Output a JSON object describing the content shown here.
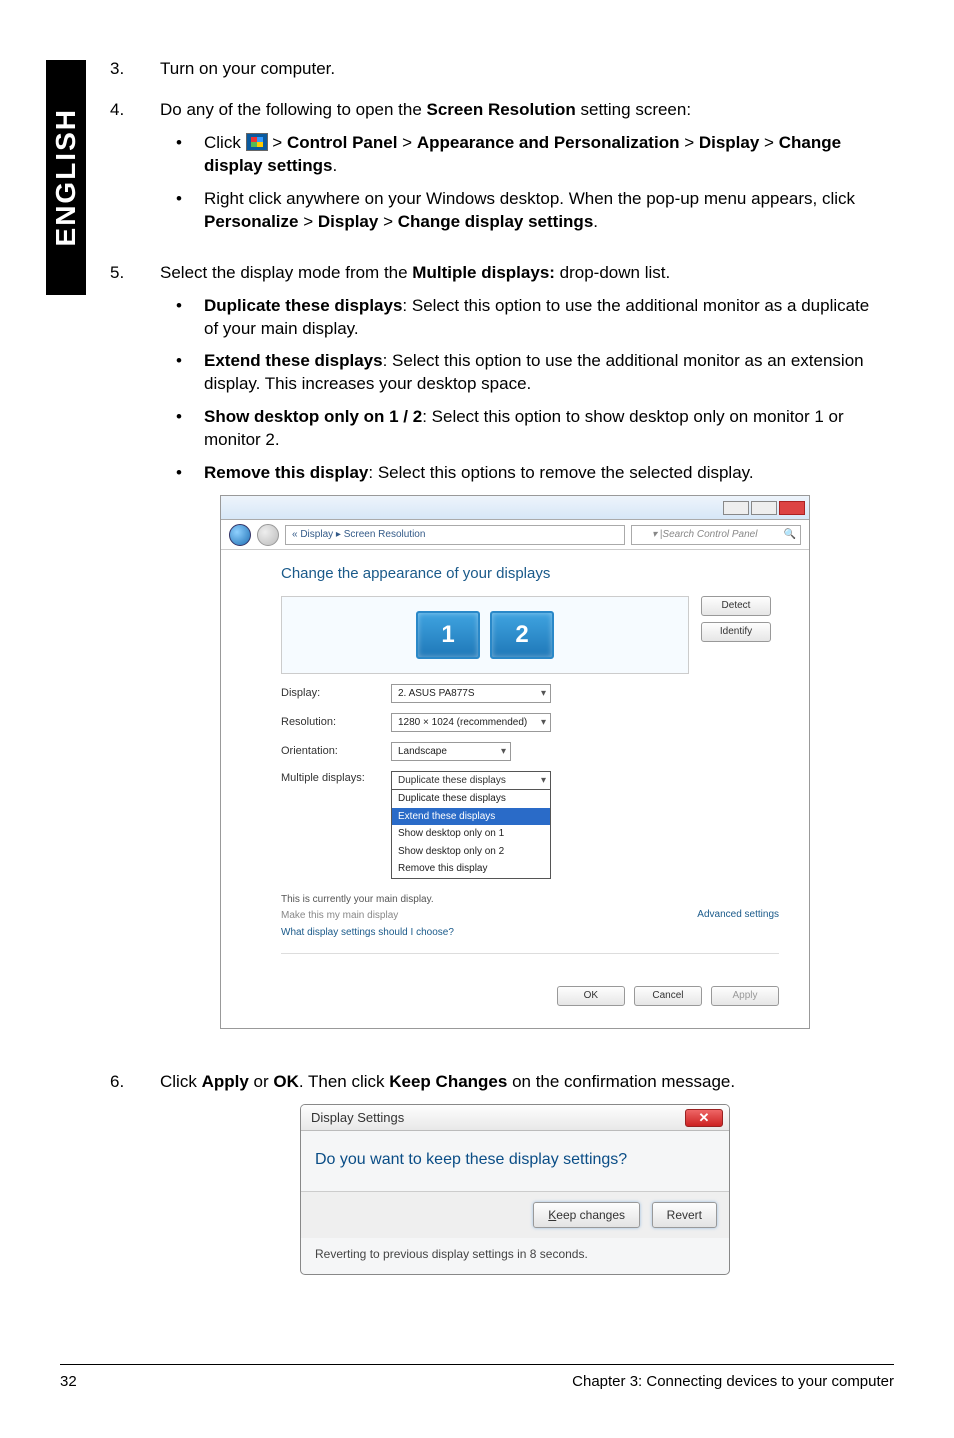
{
  "sidebar": {
    "label": "ENGLISH"
  },
  "steps": {
    "s3": {
      "num": "3.",
      "text": "Turn on your computer."
    },
    "s4": {
      "num": "4.",
      "intro_a": "Do any of the following to open the ",
      "intro_bold": "Screen Resolution",
      "intro_b": " setting screen:",
      "b1_a": "Click ",
      "b1_b": " > ",
      "b1_cp": "Control Panel",
      "b1_gt1": " > ",
      "b1_ap": "Appearance and Personalization",
      "b1_gt2": " > ",
      "b1_disp": "Display",
      "b1_gt3": " > ",
      "b1_cds": "Change display settings",
      "b1_dot": ".",
      "b2_a": "Right click anywhere on your Windows desktop. When the pop-up menu appears, click ",
      "b2_p": "Personalize",
      "b2_g1": " > ",
      "b2_d": "Display",
      "b2_g2": " > ",
      "b2_c": "Change display settings",
      "b2_dot": "."
    },
    "s5": {
      "num": "5.",
      "intro_a": "Select the display mode from the ",
      "intro_bold": "Multiple displays:",
      "intro_b": " drop-down list.",
      "i1_t": "Duplicate these displays",
      "i1_r": ": Select this option to use the additional monitor as a duplicate of your main display.",
      "i2_t": "Extend these displays",
      "i2_r": ": Select this option to use the additional monitor as an extension display. This increases your desktop space.",
      "i3_t": "Show desktop only on 1 / 2",
      "i3_r": ": Select this option to show desktop only on monitor 1 or monitor 2.",
      "i4_t": "Remove this display",
      "i4_r": ": Select this options to remove the selected display."
    },
    "s6": {
      "num": "6.",
      "a": "Click ",
      "apply": "Apply",
      "or": " or ",
      "ok": "OK",
      "b": ". Then click ",
      "kc": "Keep Changes",
      "c": " on the confirmation message."
    }
  },
  "shot1": {
    "crumb": "« Display ▸ Screen Resolution",
    "search_icon": "▾ | ",
    "search_ph": "Search Control Panel",
    "heading": "Change the appearance of your displays",
    "mon1": "1",
    "mon2": "2",
    "detect": "Detect",
    "identify": "Identify",
    "lbl_display": "Display:",
    "val_display": "2. ASUS PA877S",
    "lbl_res": "Resolution:",
    "val_res": "1280 × 1024 (recommended)",
    "lbl_orient": "Orientation:",
    "val_orient": "Landscape",
    "lbl_multi": "Multiple displays:",
    "opt0": "Duplicate these displays",
    "opt1": "Duplicate these displays",
    "opt2": "Extend these displays",
    "opt3": "Show desktop only on 1",
    "opt4": "Show desktop only on 2",
    "opt5": "Remove this display",
    "currently": "This is currently your main display.",
    "make_main": "Make this my main display",
    "adv": "Advanced settings",
    "whatlink": "What display settings should I choose?",
    "btn_ok": "OK",
    "btn_cancel": "Cancel",
    "btn_apply": "Apply"
  },
  "shot2": {
    "title": "Display Settings",
    "msg": "Do you want to keep these display settings?",
    "keep": "Keep changes",
    "keep_underline": "K",
    "revert": "Revert",
    "foot": "Reverting to previous display settings in 8 seconds."
  },
  "footer": {
    "page": "32",
    "chapter": "Chapter 3: Connecting devices to your computer"
  }
}
